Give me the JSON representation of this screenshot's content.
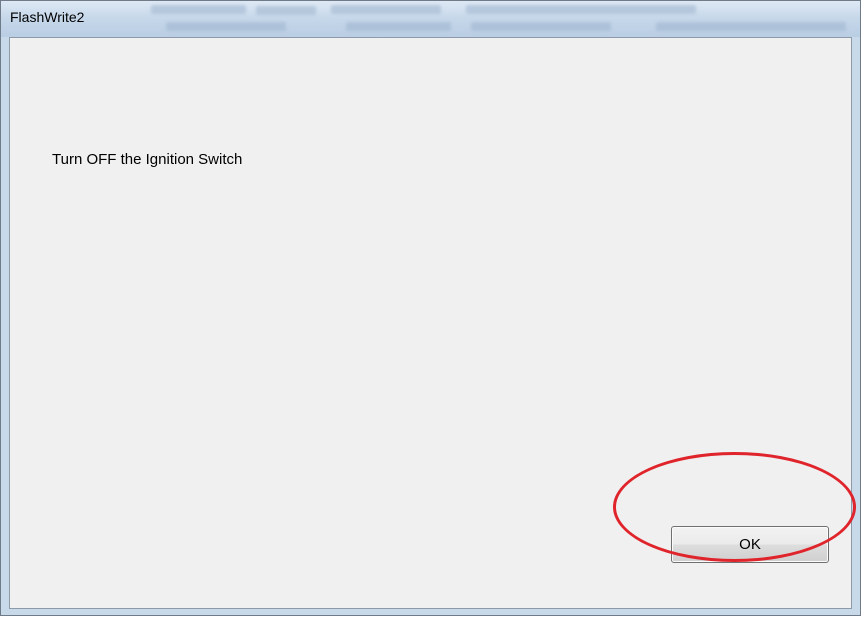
{
  "window": {
    "title": "FlashWrite2"
  },
  "dialog": {
    "message": "Turn OFF the Ignition Switch",
    "ok_label": "OK"
  },
  "annotation": {
    "highlight_color": "#e0242b",
    "highlight_target": "ok-button"
  }
}
